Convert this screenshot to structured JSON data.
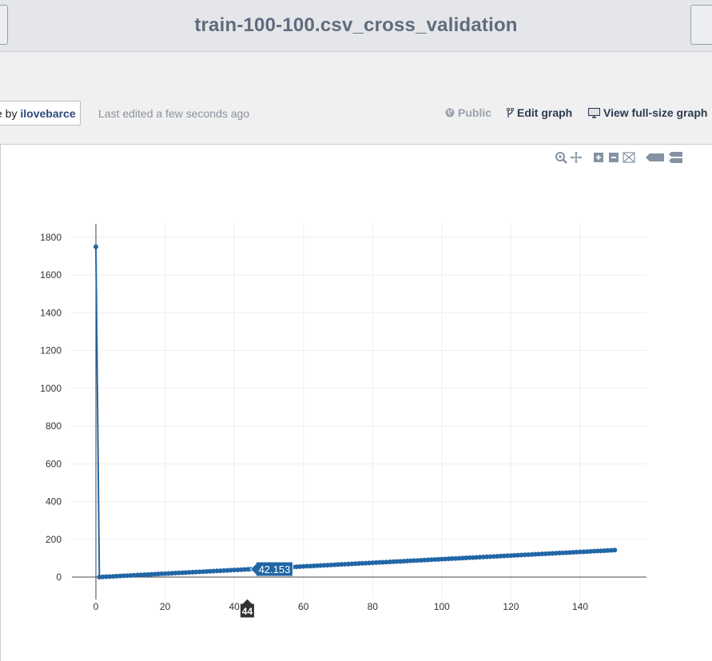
{
  "header": {
    "title": "train-100-100.csv_cross_validation"
  },
  "subbar": {
    "author_prefix": "e by ",
    "author_name": "ilovebarce",
    "last_edited": "Last edited a few seconds ago",
    "public_label": "Public",
    "edit_label": "Edit graph",
    "view_label": "View full-size graph"
  },
  "modebar": {
    "icons": [
      "zoom-icon",
      "pan-icon",
      "zoom-in-icon",
      "zoom-out-icon",
      "autoscale-icon",
      "hover-closest-icon",
      "hover-compare-icon"
    ]
  },
  "colors": {
    "series": "#2166a5",
    "hover_dark": "#333333"
  },
  "chart_data": {
    "type": "line",
    "x_start": 0,
    "x_end": 150,
    "first_value": 1750,
    "series_values_from_x1": {
      "start": 0,
      "slope": 0.958
    },
    "xlim": [
      -2,
      160
    ],
    "ylim": [
      -50,
      1850
    ],
    "x_ticks": [
      0,
      20,
      40,
      60,
      80,
      100,
      120,
      140
    ],
    "y_ticks": [
      0,
      200,
      400,
      600,
      800,
      1000,
      1200,
      1400,
      1600,
      1800
    ],
    "grid": true,
    "hover": {
      "x": 44,
      "y": 42.153,
      "x_label": "44",
      "y_label": "42.153"
    }
  }
}
